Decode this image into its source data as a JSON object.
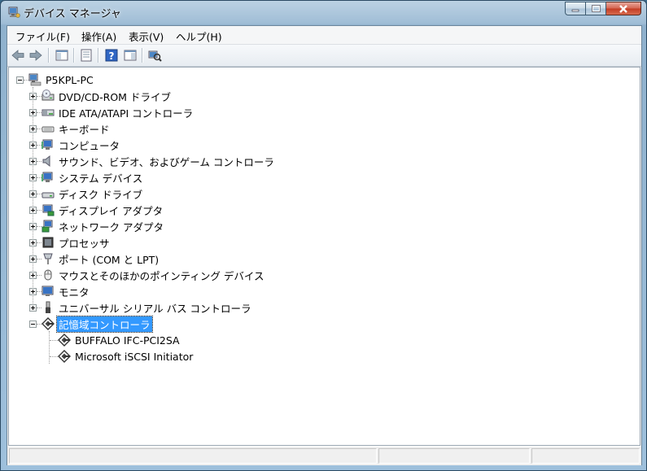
{
  "window": {
    "title": "デバイス マネージャ"
  },
  "menu": [
    {
      "label": "ファイル(F)"
    },
    {
      "label": "操作(A)"
    },
    {
      "label": "表示(V)"
    },
    {
      "label": "ヘルプ(H)"
    }
  ],
  "toolbar": {
    "buttons": [
      "back-icon",
      "forward-icon",
      "show-hide-tree-icon",
      "properties-icon",
      "help-icon",
      "action-pane-icon",
      "scan-hardware-icon"
    ]
  },
  "tree": {
    "root": {
      "label": "P5KPL-PC",
      "icon": "computer-icon"
    },
    "categories": [
      {
        "label": "DVD/CD-ROM ドライブ",
        "icon": "dvd-drive-icon"
      },
      {
        "label": "IDE ATA/ATAPI コントローラ",
        "icon": "ide-controller-icon"
      },
      {
        "label": "キーボード",
        "icon": "keyboard-icon"
      },
      {
        "label": "コンピュータ",
        "icon": "computer-monitor-icon"
      },
      {
        "label": "サウンド、ビデオ、およびゲーム コントローラ",
        "icon": "speaker-icon"
      },
      {
        "label": "システム デバイス",
        "icon": "system-devices-icon"
      },
      {
        "label": "ディスク ドライブ",
        "icon": "disk-drive-icon"
      },
      {
        "label": "ディスプレイ アダプタ",
        "icon": "display-adapter-icon"
      },
      {
        "label": "ネットワーク アダプタ",
        "icon": "network-adapter-icon"
      },
      {
        "label": "プロセッサ",
        "icon": "processor-icon"
      },
      {
        "label": "ポート (COM と LPT)",
        "icon": "port-icon"
      },
      {
        "label": "マウスとそのほかのポインティング デバイス",
        "icon": "mouse-icon"
      },
      {
        "label": "モニタ",
        "icon": "monitor-icon"
      },
      {
        "label": "ユニバーサル シリアル バス コントローラ",
        "icon": "usb-icon"
      },
      {
        "label": "記憶域コントローラ",
        "icon": "storage-controller-icon",
        "expanded": true,
        "selected": true
      }
    ],
    "children": [
      {
        "label": "BUFFALO IFC-PCI2SA",
        "icon": "storage-controller-icon"
      },
      {
        "label": "Microsoft iSCSI Initiator",
        "icon": "storage-controller-icon"
      }
    ]
  },
  "colors": {
    "selection": "#3399ff",
    "titlebar": "#9fbdd6",
    "close_button": "#c33b22"
  }
}
